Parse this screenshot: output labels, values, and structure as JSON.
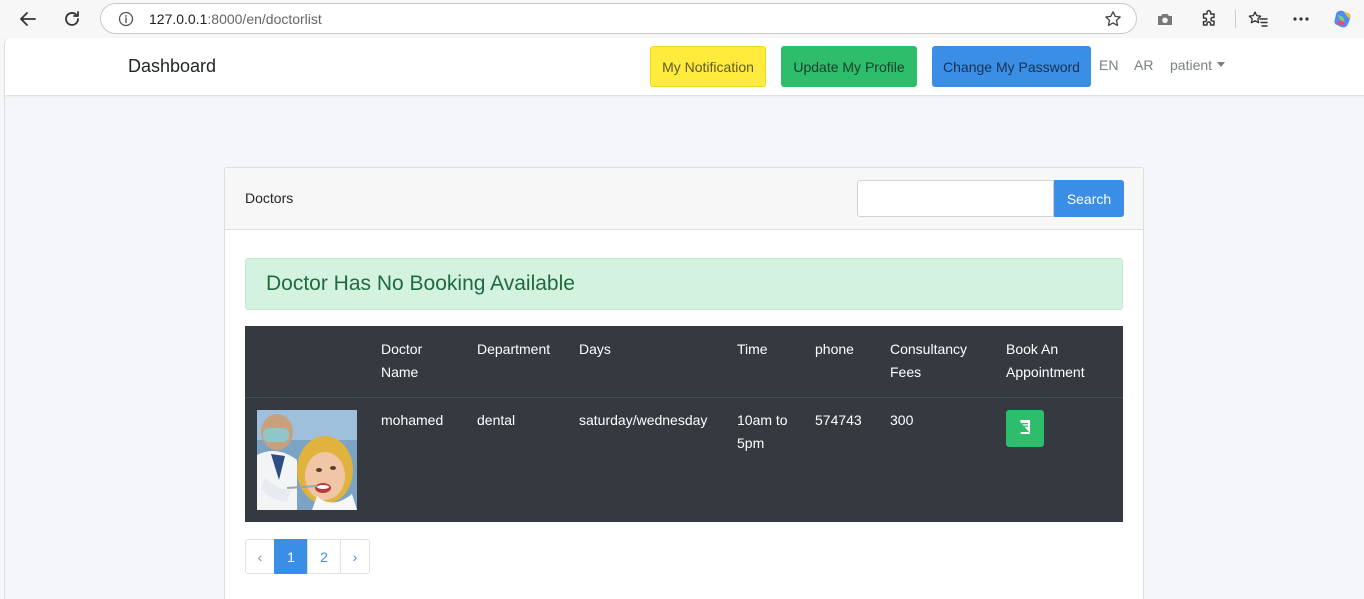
{
  "browser": {
    "url_host": "127.0.0.1",
    "url_path": ":8000/en/doctorlist"
  },
  "navbar": {
    "brand": "Dashboard",
    "notification_btn": "My Notification",
    "profile_btn": "Update My Profile",
    "password_btn": "Change My Password",
    "lang_en": "EN",
    "lang_ar": "AR",
    "user": "patient"
  },
  "card": {
    "title": "Doctors",
    "search_placeholder": "",
    "search_btn": "Search",
    "alert": "Doctor Has No Booking Available"
  },
  "table": {
    "headers": {
      "name": [
        "Doctor",
        "Name"
      ],
      "department": "Department",
      "days": "Days",
      "time": "Time",
      "phone": "phone",
      "fees": [
        "Consultancy",
        "Fees"
      ],
      "book": [
        "Book An",
        "Appointment"
      ]
    },
    "rows": [
      {
        "name": "mohamed",
        "department": "dental",
        "days": "saturday/wednesday",
        "time": [
          "10am to",
          "5pm"
        ],
        "phone": "574743",
        "fees": "300"
      }
    ]
  },
  "pagination": {
    "prev": "‹",
    "pages": [
      "1",
      "2"
    ],
    "active": "1",
    "next": "›"
  },
  "colors": {
    "warning": "#ffeb3b",
    "success": "#2ebd6b",
    "primary": "#3a8ee6",
    "table_dark": "#343a40",
    "alert_bg": "#d4f2e0"
  }
}
